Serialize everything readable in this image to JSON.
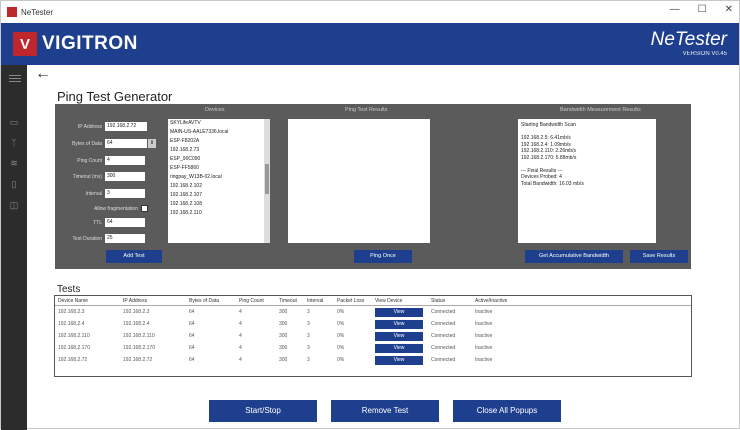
{
  "window": {
    "title": "NeTester",
    "controls": [
      "—",
      "☐",
      "✕"
    ]
  },
  "brand": {
    "logo_mark": "V",
    "logo_text": "VIGITRON",
    "product": "NeTester",
    "version": "VERSION V0.45"
  },
  "nav": {
    "back": "←",
    "rail_icons": [
      "monitor-icon",
      "antenna-icon",
      "wifi-icon",
      "document-icon",
      "save-icon"
    ]
  },
  "page": {
    "title": "Ping Test Generator"
  },
  "groups": {
    "devices": "Devices",
    "ping_results": "Ping Test Results",
    "bandwidth": "Bandwidth Measurement Results"
  },
  "form": [
    {
      "label": "IP Address",
      "value": "192.168.2.72"
    },
    {
      "label": "Bytes of Data",
      "value": "64"
    },
    {
      "label": "Ping Count",
      "value": "4"
    },
    {
      "label": "Timeout (ms)",
      "value": "300"
    },
    {
      "label": "Interval",
      "value": "3"
    },
    {
      "label": "Allow fragmentation",
      "value": "",
      "checked": true
    },
    {
      "label": "TTL",
      "value": "64"
    },
    {
      "label": "Test Duration",
      "value": "25"
    }
  ],
  "devices": [
    "SKYLifeAVTV",
    "MAIN-US-AALE7336.local",
    "ESP-F8202A",
    "192.168.2.73",
    "ESP_90C090",
    "ESP-FF5860",
    "ringpay_W13B-02.local",
    "192.168.2.102",
    "192.168.2.107",
    "192.168.2.108",
    "192.168.2.110"
  ],
  "bandwidth_text": [
    "Starting Bandwidth Scan",
    "",
    "192.168.2.5:   6.41mb/s",
    "192.168.2.4:   1.09mb/s",
    "192.168.2.110:   2.26mb/s",
    "192.168.2.170:   5.88mb/s",
    "",
    "--- Final Results ---",
    "Devices Probed: 4",
    "Total Bandwidth: 16.03 mb/s"
  ],
  "buttons": {
    "add_test": "Add Test",
    "ping_once": "Ping Once",
    "get_bw": "Get Accumulative Bandwidth",
    "save_results": "Save Results",
    "start_stop": "Start/Stop",
    "remove_test": "Remove Test",
    "close_popups": "Close All Popups"
  },
  "tests": {
    "title": "Tests",
    "columns": [
      "Device Name",
      "IP Address",
      "Bytes of Data",
      "Ping Count",
      "Timeout",
      "Interval",
      "Packet Loss",
      "View Device",
      "Status",
      "Active/Inactive"
    ],
    "rows": [
      [
        "192.168.2.3",
        "192.168.2.3",
        "64",
        "4",
        "300",
        "3",
        "0%",
        "View",
        "Connected",
        "Inactive"
      ],
      [
        "192.168.2.4",
        "192.168.2.4",
        "64",
        "4",
        "300",
        "3",
        "0%",
        "View",
        "Connected",
        "Inactive"
      ],
      [
        "192.168.2.110",
        "192.168.2.110",
        "64",
        "4",
        "300",
        "3",
        "0%",
        "View",
        "Connected",
        "Inactive"
      ],
      [
        "192.168.2.170",
        "192.168.2.170",
        "64",
        "4",
        "300",
        "3",
        "0%",
        "View",
        "Connected",
        "Inactive"
      ],
      [
        "192.168.2.72",
        "192.168.2.72",
        "64",
        "4",
        "300",
        "3",
        "0%",
        "View",
        "Connected",
        "Inactive"
      ]
    ]
  },
  "colors": {
    "brand_blue": "#1e3f8e",
    "brand_red": "#c0272d",
    "panel_gray": "#5b5b5b"
  }
}
